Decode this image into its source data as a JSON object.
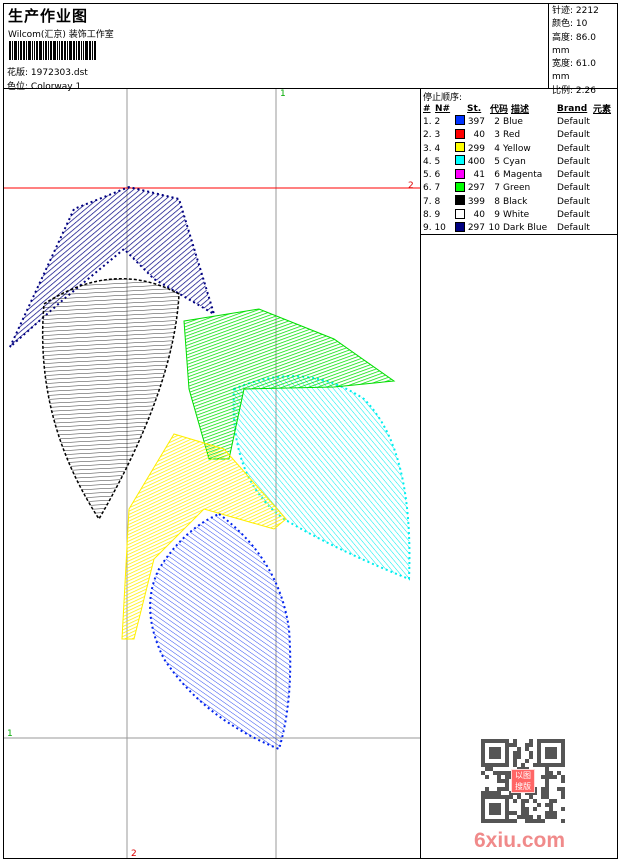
{
  "header": {
    "title": "生产作业图",
    "company": "Wilcom(汇京) 装饰工作室",
    "design_label": "花版:",
    "design_file": "1972303.dst",
    "colorway_label": "色位:",
    "colorway": "Colorway 1"
  },
  "stats": [
    {
      "label": "针迹:",
      "value": "2212"
    },
    {
      "label": "颜色:",
      "value": "10"
    },
    {
      "label": "高度:",
      "value": "86.0 mm"
    },
    {
      "label": "宽度:",
      "value": "61.0 mm"
    },
    {
      "label": "比例:",
      "value": "2.26"
    }
  ],
  "stop_sequence": {
    "title": "停止顺序:",
    "headers": [
      "#",
      "N#",
      "St.",
      "代码",
      "描述",
      "Brand",
      "元素"
    ],
    "rows": [
      {
        "seq": "1. 2",
        "color": "#0033ff",
        "st": "397",
        "code": "2",
        "desc": "Blue",
        "brand": "Default"
      },
      {
        "seq": "2. 3",
        "color": "#ff0000",
        "st": "40",
        "code": "3",
        "desc": "Red",
        "brand": "Default"
      },
      {
        "seq": "3. 4",
        "color": "#ffff00",
        "st": "299",
        "code": "4",
        "desc": "Yellow",
        "brand": "Default"
      },
      {
        "seq": "4. 5",
        "color": "#00ffff",
        "st": "400",
        "code": "5",
        "desc": "Cyan",
        "brand": "Default"
      },
      {
        "seq": "5. 6",
        "color": "#ff00ff",
        "st": "41",
        "code": "6",
        "desc": "Magenta",
        "brand": "Default"
      },
      {
        "seq": "6. 7",
        "color": "#00ff00",
        "st": "297",
        "code": "7",
        "desc": "Green",
        "brand": "Default"
      },
      {
        "seq": "7. 8",
        "color": "#000000",
        "st": "399",
        "code": "8",
        "desc": "Black",
        "brand": "Default"
      },
      {
        "seq": "8. 9",
        "color": "#ffffff",
        "st": "40",
        "code": "9",
        "desc": "White",
        "brand": "Default"
      },
      {
        "seq": "9. 10",
        "color": "#000080",
        "st": "297",
        "code": "10",
        "desc": "Dark Blue",
        "brand": "Default"
      }
    ]
  },
  "guides": {
    "top_v": "1",
    "right_h": "2",
    "left_h": "1",
    "bottom_v": "2"
  },
  "watermark": {
    "site": "6xiu.com",
    "seal": "以图搜版"
  }
}
